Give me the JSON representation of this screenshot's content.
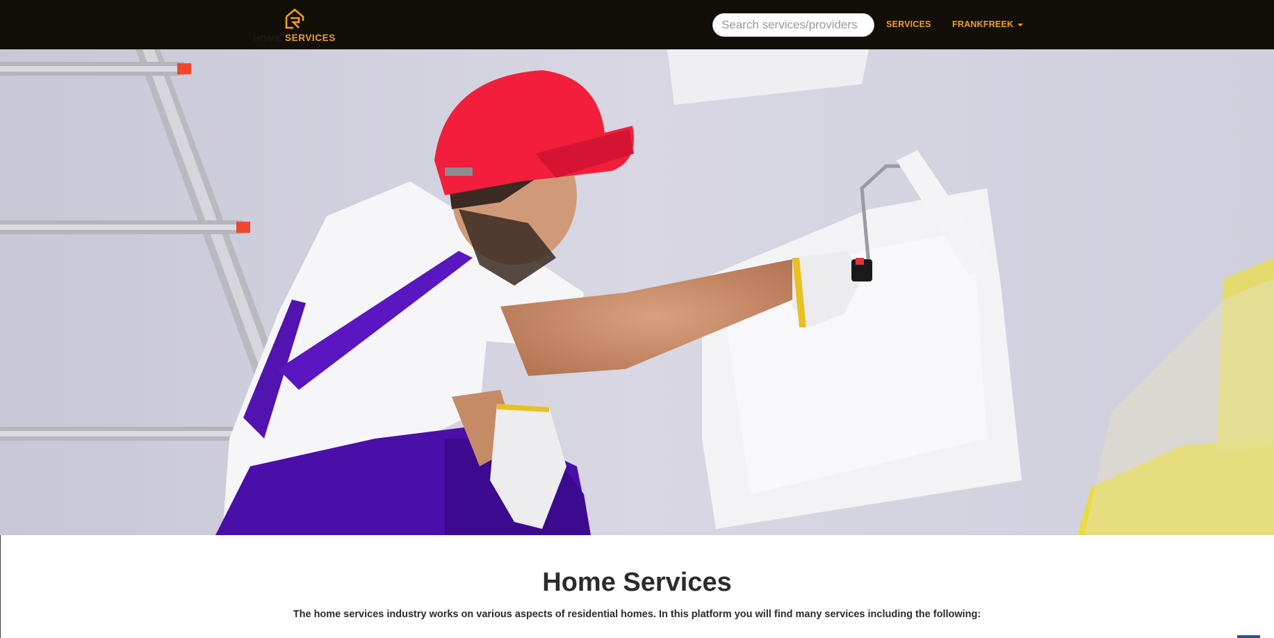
{
  "brand": {
    "label_dim": "HOME",
    "label": "SERVICES",
    "logo_icon": "house-logo-icon",
    "accent_color": "#f0a020"
  },
  "nav": {
    "search_placeholder": "Search services/providers",
    "services_label": "SERVICES",
    "user_label": "FRANKFREEK",
    "user_menu_icon": "caret-down-icon"
  },
  "hero": {
    "image": "painter-with-roller-image"
  },
  "main": {
    "heading": "Home Services",
    "intro": "The home services industry works on various aspects of residential homes. In this platform you will find many services including the following:"
  }
}
